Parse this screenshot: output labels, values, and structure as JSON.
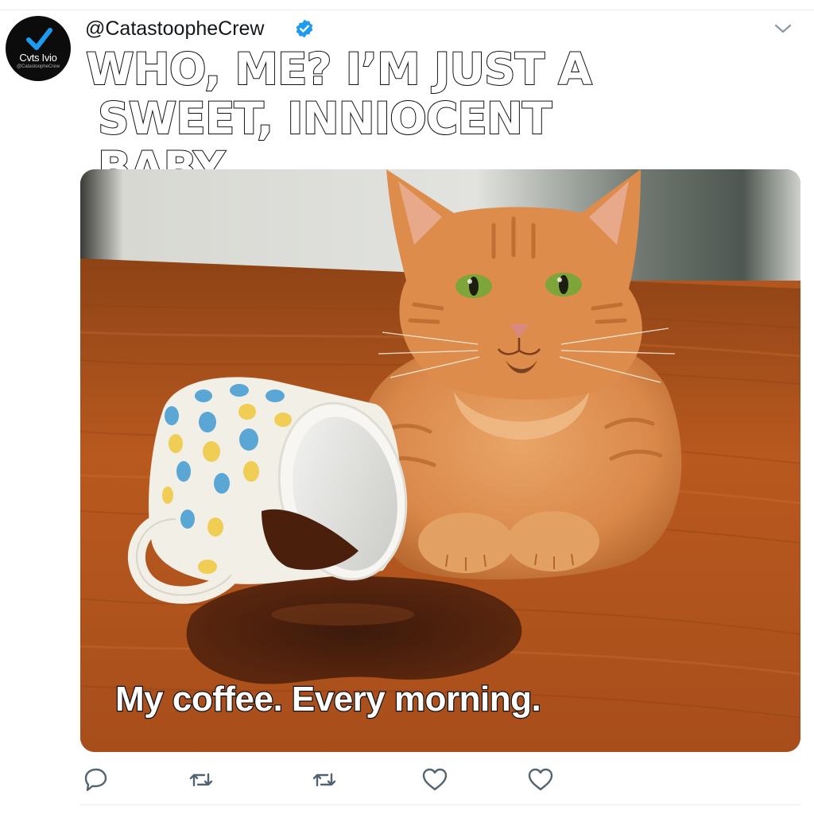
{
  "profile": {
    "avatar_name": "Cvts Ivio",
    "avatar_subtext": "@CatastoopheCrew"
  },
  "tweet": {
    "handle": "@CatastoopheCrew",
    "verified_icon": "verified-badge-icon",
    "more_icon": "chevron-down-icon",
    "meme_top_line1": "WHO, ME? I’M JUST A",
    "meme_top_line2": "SWEET, INNIOCENT BABY",
    "image_caption": "My coffee. Every morning.",
    "image_alt_subject": "orange tabby cat beside a tipped polka-dot mug and spilled coffee"
  },
  "actions": [
    {
      "name": "reply",
      "icon": "reply-icon"
    },
    {
      "name": "retweet",
      "icon": "retweet-icon"
    },
    {
      "name": "retweet",
      "icon": "retweet-icon"
    },
    {
      "name": "like",
      "icon": "heart-icon"
    },
    {
      "name": "like",
      "icon": "heart-icon"
    }
  ],
  "colors": {
    "verified_blue": "#1d9bf0",
    "icon_gray": "#536471",
    "handle_text": "#14171a"
  }
}
